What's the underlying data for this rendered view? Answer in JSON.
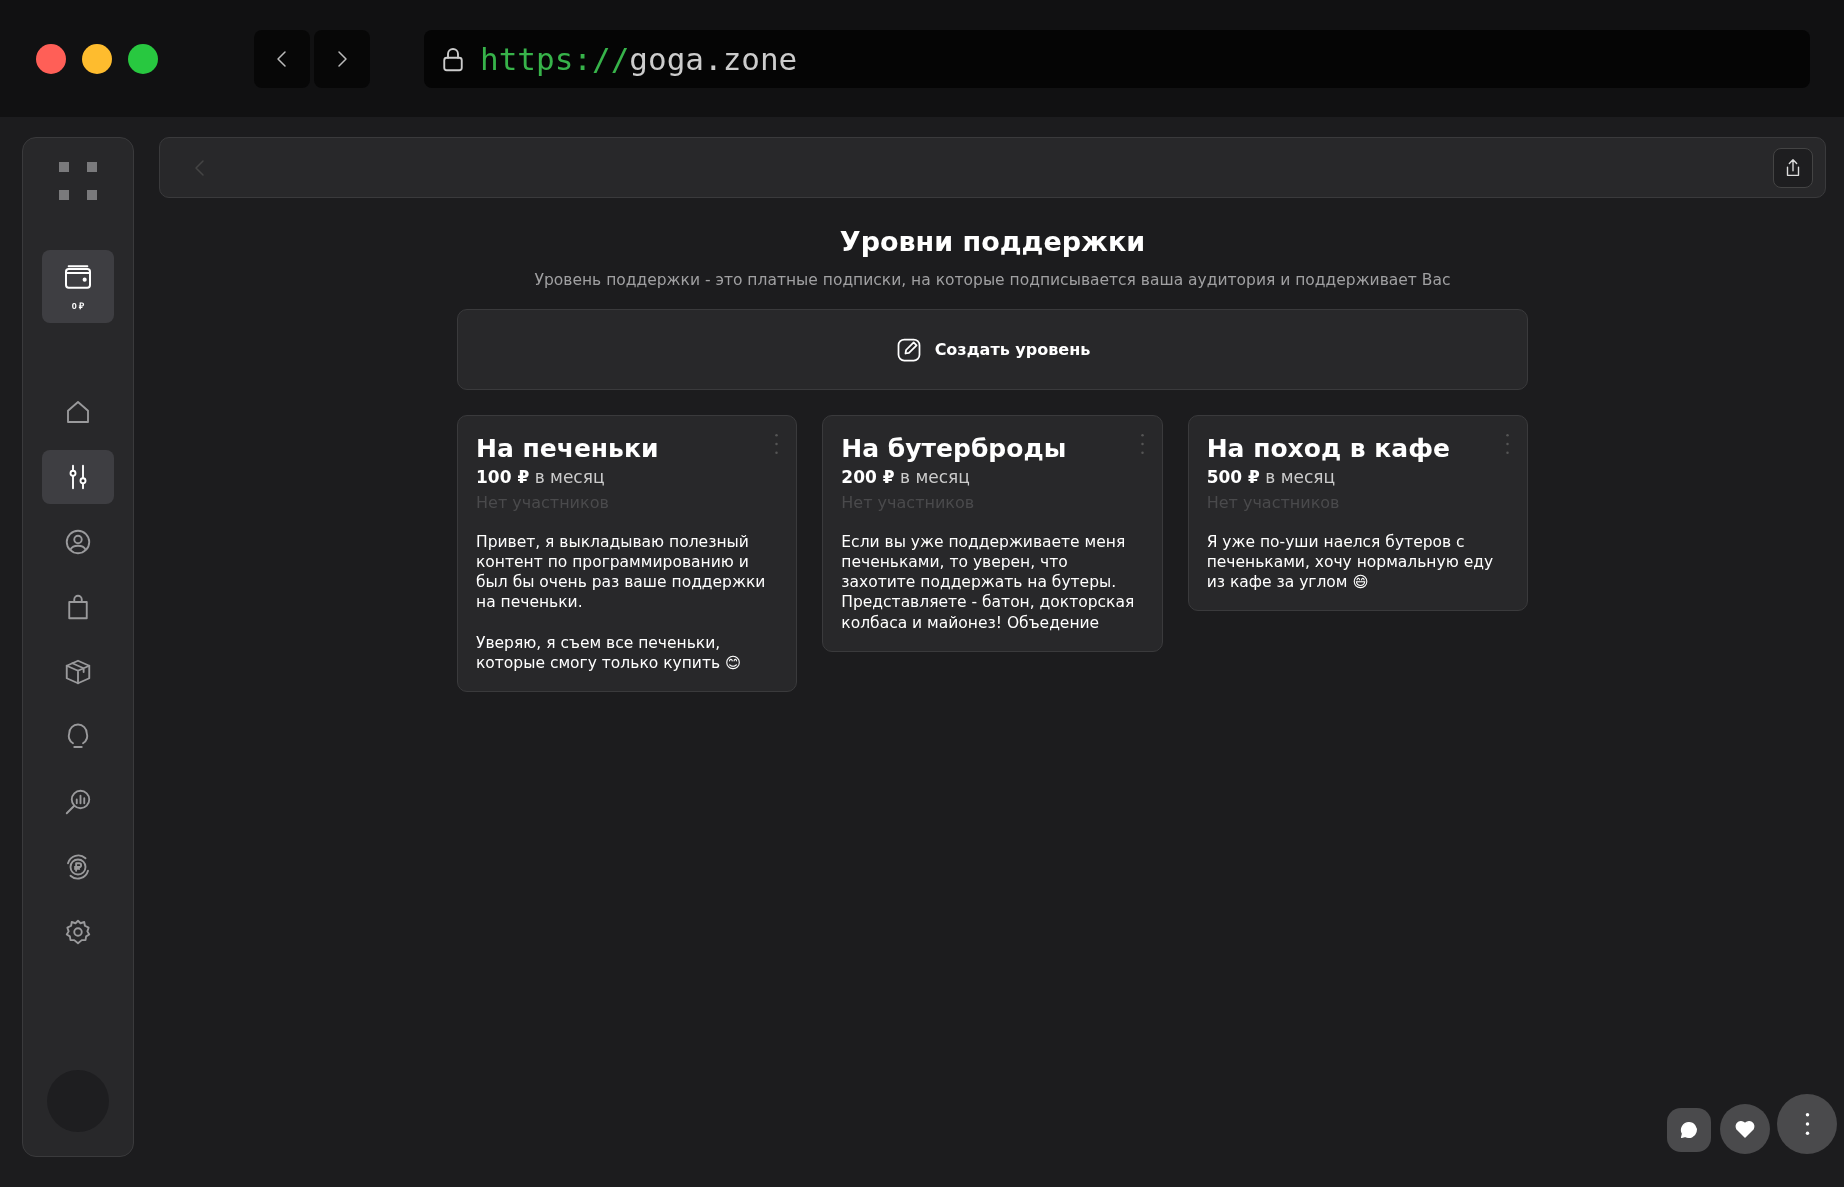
{
  "browser": {
    "url_scheme": "https://",
    "url_host": "goga.zone"
  },
  "sidebar": {
    "wallet": {
      "balance": "0 ₽",
      "selected": true
    },
    "items": [
      {
        "kind": "home",
        "selected": false
      },
      {
        "kind": "sliders",
        "selected": true
      },
      {
        "kind": "user",
        "selected": false
      },
      {
        "kind": "bag",
        "selected": false
      },
      {
        "kind": "box",
        "selected": false
      },
      {
        "kind": "bulb",
        "selected": false
      },
      {
        "kind": "analytics",
        "selected": false
      },
      {
        "kind": "ruble",
        "selected": false
      },
      {
        "kind": "settings",
        "selected": false
      }
    ]
  },
  "page": {
    "title": "Уровни поддержки",
    "subtitle": "Уровень поддержки - это платные подписки, на которые подписывается ваша аудитория и поддерживает Вас",
    "create_button": "Создать уровень"
  },
  "tiers": [
    {
      "title": "На печеньки",
      "price": "**100 ₽** в месяц",
      "members": "Нет участников",
      "paragraphs": [
        "Привет, я выкладываю полезный контент по программированию и был бы очень раз ваше поддержки на печеньки.",
        "Уверяю, я съем все печеньки, которые смогу только купить 😊"
      ]
    },
    {
      "title": "На бутерброды",
      "price": "**200 ₽** в месяц",
      "members": "Нет участников",
      "paragraphs": [
        "Если вы уже поддерживаете меня печеньками, то уверен, что захотите поддержать на бутеры. Представляете - батон, докторская колбаса и майонез! Объедение"
      ]
    },
    {
      "title": "На поход в кафе",
      "price": "**500 ₽** в месяц",
      "members": "Нет участников",
      "paragraphs": [
        "Я уже по-уши наелся бутеров с печеньками, хочу нормальную еду из кафе за углом 😄"
      ]
    }
  ]
}
